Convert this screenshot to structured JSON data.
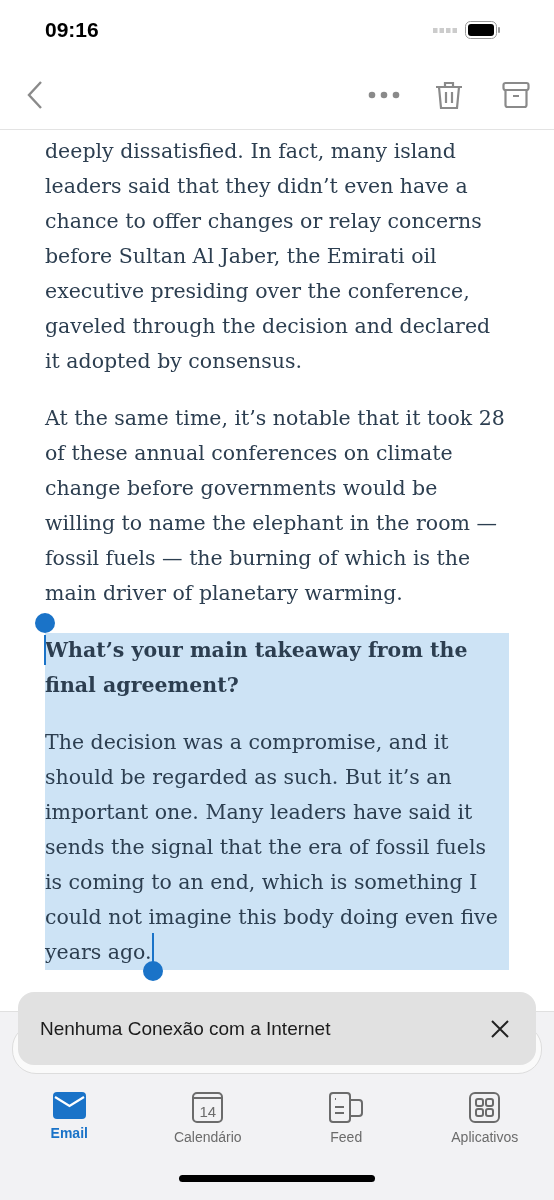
{
  "status_bar": {
    "time": "09:16"
  },
  "article": {
    "blocks": [
      {
        "kind": "paragraph",
        "text": "deeply dissatisfied. In fact, many island leaders said that they didn’t even have a chance to offer changes or relay concerns before Sultan Al Jaber, the Emirati oil executive presiding over the conference, gaveled through the decision and declared it adopted by consensus.",
        "selected": false
      },
      {
        "kind": "paragraph",
        "text": "At the same time, it’s notable that it took 28 of these annual conferences on climate change before governments would be willing to name the elephant in the room — fossil fuels — the burning of which is the main driver of planetary warming.",
        "selected": false
      },
      {
        "kind": "heading",
        "text": "What’s your main takeaway from the final agreement?",
        "selected": true
      },
      {
        "kind": "paragraph",
        "text": "The decision was a compromise, and it should be regarded as such. But it’s an important one. Many leaders have said it sends the signal that the era of fossil fuels is coming to an end, which is something I could not imagine this body doing even five years ago.",
        "selected": true
      }
    ]
  },
  "toast": {
    "message": "Nenhuma Conexão com a Internet"
  },
  "tabs": [
    {
      "kind": "mail",
      "label": "Email",
      "selected": true
    },
    {
      "kind": "calendar",
      "label": "Calendário",
      "icon_text": "14",
      "selected": false
    },
    {
      "kind": "feed",
      "label": "Feed",
      "selected": false
    },
    {
      "kind": "apps",
      "label": "Aplicativos",
      "selected": false
    }
  ]
}
